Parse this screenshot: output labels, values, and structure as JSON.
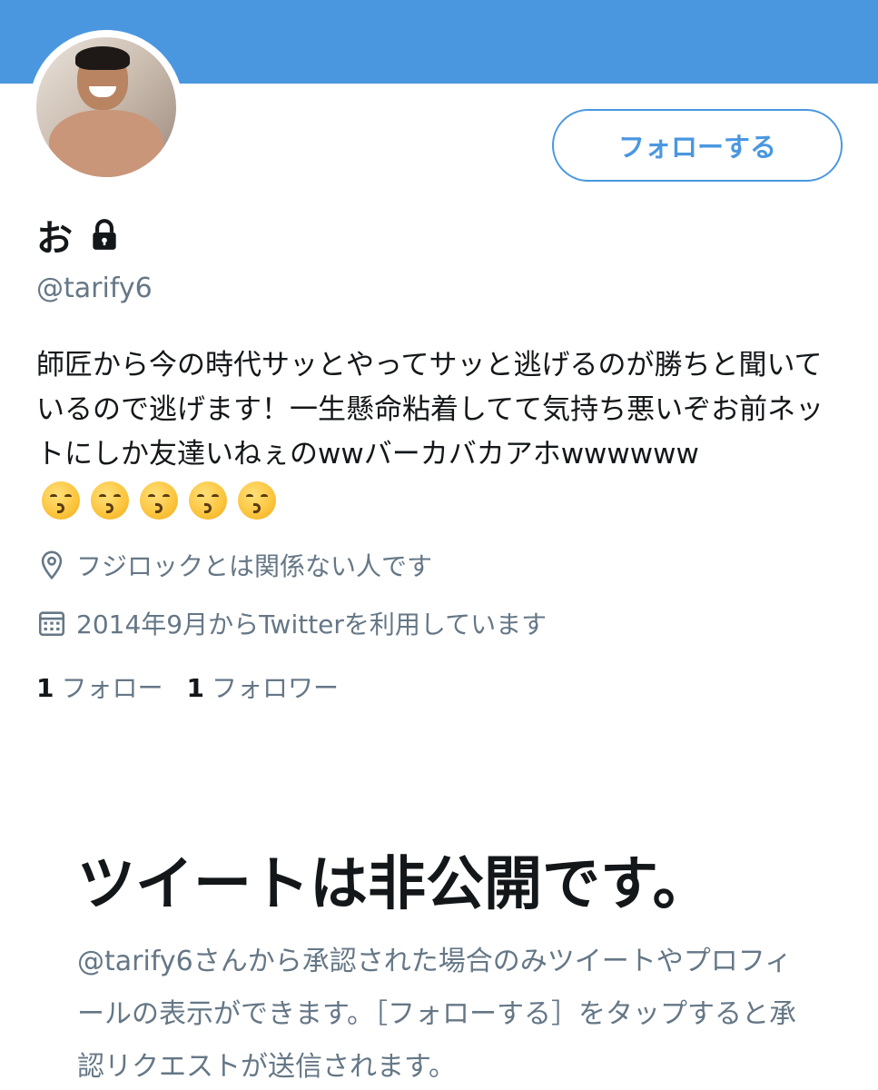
{
  "profile": {
    "display_name": "お",
    "handle": "@tarify6",
    "bio_text": "師匠から今の時代サッとやってサッと逃げるのが勝ちと聞いているので逃げます！一生懸命粘着してて気持ち悪いぞお前ネットにしか友達いねぇのwwバーカバカアホwwwwww",
    "bio_emojis": [
      "kissing-face",
      "kissing-face",
      "kissing-face",
      "kissing-face",
      "kissing-face"
    ],
    "location": "フジロックとは関係ない人です",
    "joined": "2014年9月からTwitterを利用しています",
    "following_count": "1",
    "following_label": "フォロー",
    "followers_count": "1",
    "followers_label": "フォロワー"
  },
  "actions": {
    "follow_label": "フォローする"
  },
  "protected_notice": {
    "title": "ツイートは非公開です。",
    "description": "@tarify6さんから承認された場合のみツイートやプロフィールの表示ができます。［フォローする］をタップすると承認リクエストが送信されます。"
  },
  "colors": {
    "banner": "#4a97e0",
    "accent": "#4a97e0",
    "secondary_text": "#657786",
    "primary_text": "#14171a"
  },
  "icons": {
    "lock": "lock-icon",
    "location": "location-pin-icon",
    "calendar": "calendar-icon"
  }
}
